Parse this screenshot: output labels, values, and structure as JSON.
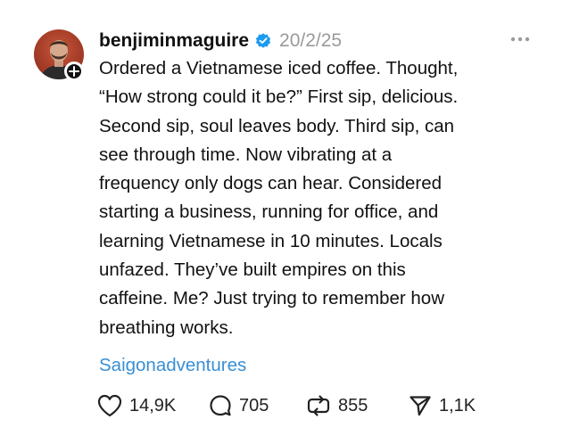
{
  "post": {
    "author": {
      "username": "benjiminmaguire",
      "verified_icon": "verified-badge-icon",
      "avatar_icon": "avatar-photo"
    },
    "timestamp": "20/2/25",
    "more_icon": "more-options-icon",
    "body_lines": [
      "Ordered a Vietnamese iced coffee. Thought,",
      "“How strong could it be?” First sip, delicious.",
      "Second sip, soul leaves body. Third sip, can",
      "see through time. Now vibrating at a",
      "frequency only dogs can hear. Considered",
      "starting a business, running for office, and",
      "learning Vietnamese in 10 minutes.  Locals",
      "unfazed. They’ve built empires on this",
      "caffeine. Me? Just trying to remember how",
      "breathing works."
    ],
    "hashtag": "Saigonadventures",
    "actions": {
      "likes": "14,9K",
      "replies": "705",
      "reposts": "855",
      "shares": "1,1K"
    }
  },
  "colors": {
    "text": "#111111",
    "muted": "#9a9a9a",
    "link": "#3a8fd4",
    "verified": "#1d9bf0"
  }
}
